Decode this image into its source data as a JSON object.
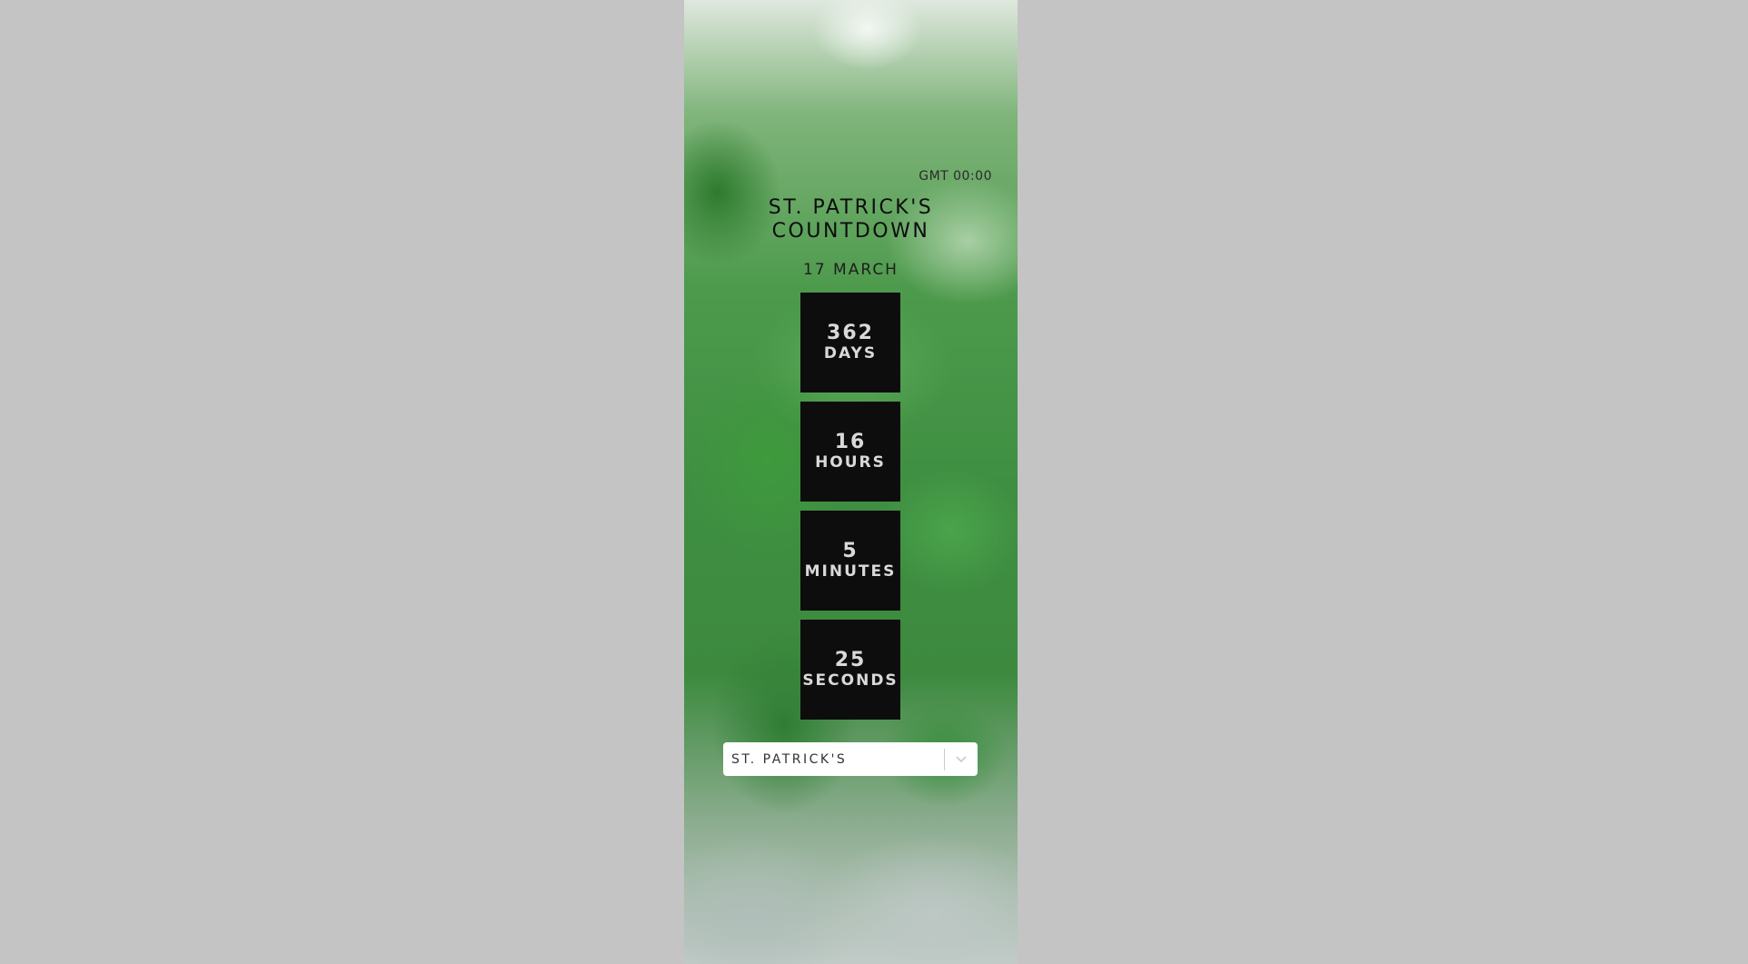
{
  "timezone_label": "GMT 00:00",
  "title_line1": "ST. PATRICK'S",
  "title_line2": "COUNTDOWN",
  "date": "17 MARCH",
  "countdown": [
    {
      "value": "362",
      "unit": "DAYS"
    },
    {
      "value": "16",
      "unit": "HOURS"
    },
    {
      "value": "5",
      "unit": "MINUTES"
    },
    {
      "value": "25",
      "unit": "SECONDS"
    }
  ],
  "holiday_select": {
    "selected": "ST. PATRICK'S",
    "icon": "chevron-down-icon"
  },
  "colors": {
    "page_background": "#c4c4c4",
    "tile_background": "#0d0d0d",
    "tile_text": "#d9d9d9"
  }
}
